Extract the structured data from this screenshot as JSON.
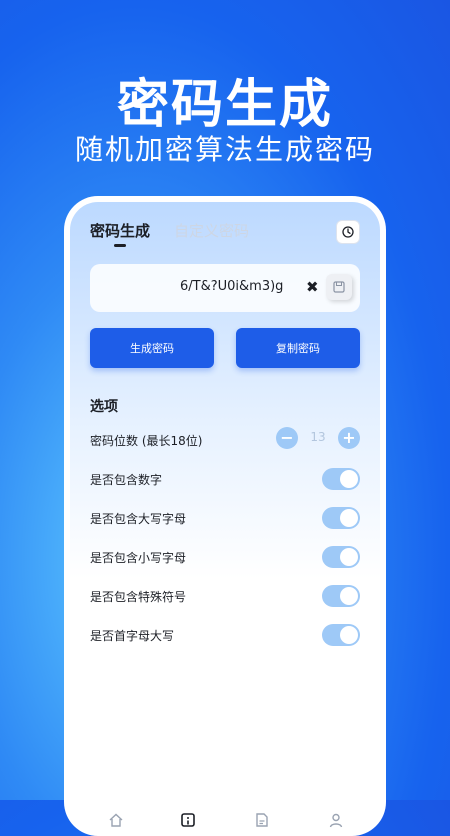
{
  "promo": {
    "title": "密码生成",
    "subtitle": "随机加密算法生成密码"
  },
  "tabs": [
    {
      "label": "密码生成",
      "active": true
    },
    {
      "label": "自定义密码",
      "active": false
    }
  ],
  "password": {
    "value": "6/T&?U0i&m3)g",
    "clear_glyph": "✖"
  },
  "buttons": {
    "generate": "生成密码",
    "copy": "复制密码"
  },
  "options": {
    "title": "选项",
    "length_label": "密码位数 (最长18位)",
    "length_value": "13",
    "minus_glyph": "−",
    "plus_glyph": "+",
    "toggles": [
      {
        "label": "是否包含数字",
        "on": true
      },
      {
        "label": "是否包含大写字母",
        "on": true
      },
      {
        "label": "是否包含小写字母",
        "on": true
      },
      {
        "label": "是否包含特殊符号",
        "on": true
      },
      {
        "label": "是否首字母大写",
        "on": true
      }
    ]
  },
  "colors": {
    "accent": "#1e5de8",
    "toggle_on": "#9ec9f7"
  },
  "icons": {
    "history": "clock-icon",
    "save": "save-icon",
    "nav": [
      "home-icon",
      "generator-icon",
      "document-icon",
      "profile-icon"
    ]
  }
}
